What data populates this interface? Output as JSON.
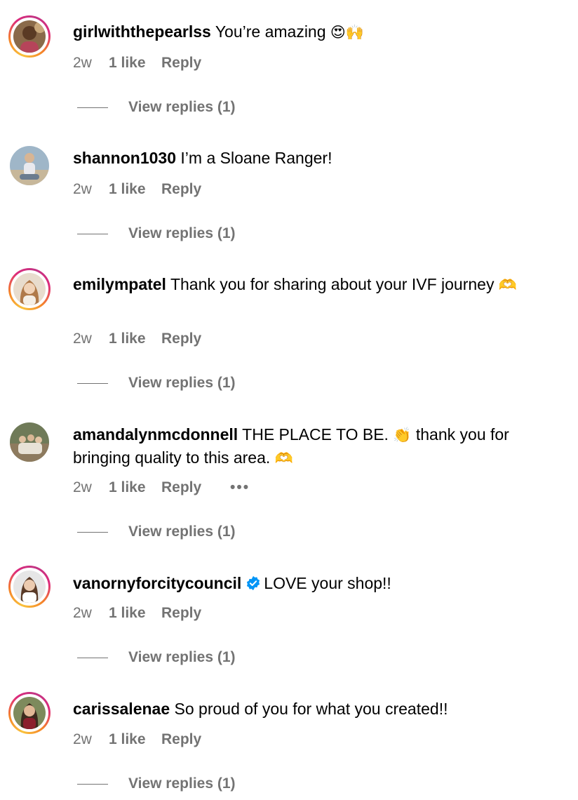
{
  "comments": [
    {
      "username": "girlwiththepearlss",
      "text": "You’re amazing",
      "emoji": "😍🙌",
      "time": "2w",
      "likes": "1 like",
      "reply": "Reply",
      "view_replies": "View replies (1)",
      "has_story_ring": true
    },
    {
      "username": "shannon1030",
      "text": "I’m a Sloane Ranger!",
      "time": "2w",
      "likes": "1 like",
      "reply": "Reply",
      "view_replies": "View replies (1)",
      "has_story_ring": false
    },
    {
      "username": "emilympatel",
      "text": "Thank you for sharing about your IVF journey",
      "emoji": "🫶",
      "time": "2w",
      "likes": "1 like",
      "reply": "Reply",
      "view_replies": "View replies (1)",
      "has_story_ring": true
    },
    {
      "username": "amandalynmcdonnell",
      "text_part1": "THE PLACE TO BE.",
      "emoji1": "👏",
      "text_part2": "thank you for",
      "text_line2": "bringing quality to this area.",
      "emoji2": "🫶",
      "time": "2w",
      "likes": "1 like",
      "reply": "Reply",
      "more": "•••",
      "view_replies": "View replies (1)",
      "has_story_ring": false
    },
    {
      "username": "vanornyforcitycouncil",
      "verified": true,
      "text": "LOVE your shop!!",
      "time": "2w",
      "likes": "1 like",
      "reply": "Reply",
      "view_replies": "View replies (1)",
      "has_story_ring": true
    },
    {
      "username": "carissalenae",
      "text": "So proud of you for what you created!!",
      "time": "2w",
      "likes": "1 like",
      "reply": "Reply",
      "view_replies": "View replies (1)",
      "has_story_ring": true
    }
  ],
  "colors": {
    "meta_gray": "#737373",
    "verified_blue": "#0095f6",
    "story_ring": [
      "#f9c23c",
      "#f58529",
      "#dd2a7b",
      "#c13584"
    ]
  }
}
